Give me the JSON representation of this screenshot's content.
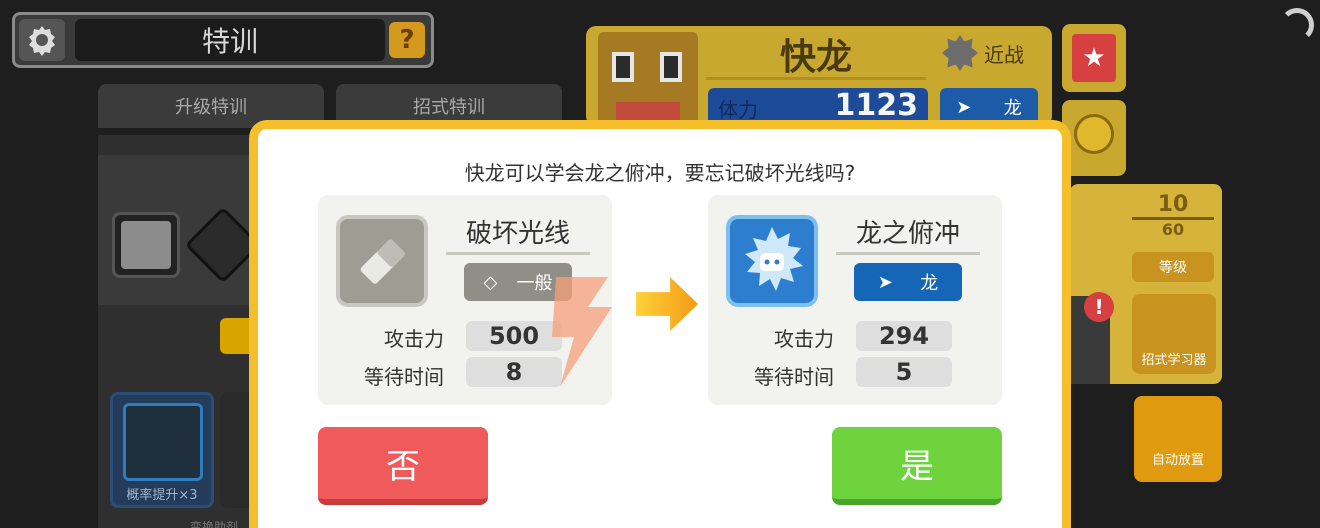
{
  "header": {
    "title": "特训",
    "help_label": "?"
  },
  "tabs": [
    {
      "label": "升级特训"
    },
    {
      "label": "招式特训"
    }
  ],
  "left_panel": {
    "boost_label": "概率提升×3",
    "bottom_text": "变换助剂"
  },
  "monster": {
    "name": "快龙",
    "attack_style": "近战",
    "hp_label": "体力",
    "hp_value": "1123",
    "type_label": "龙",
    "level": "10",
    "level_max": "60",
    "level_label": "等级",
    "move_learner_label": "招式学习器",
    "auto_place_label": "自动放置",
    "alert": "!"
  },
  "dialog": {
    "question": "快龙可以学会龙之俯冲，要忘记破坏光线吗?",
    "old_move": {
      "name": "破坏光线",
      "type": "一般",
      "attack_label": "攻击力",
      "attack_value": "500",
      "wait_label": "等待时间",
      "wait_value": "8"
    },
    "new_move": {
      "name": "龙之俯冲",
      "type": "龙",
      "attack_label": "攻击力",
      "attack_value": "294",
      "wait_label": "等待时间",
      "wait_value": "5"
    },
    "no_label": "否",
    "yes_label": "是"
  },
  "colors": {
    "frame": "#f5bf2c",
    "no_button": "#f05a5a",
    "yes_button": "#6ed33d",
    "dragon_type": "#1666b8",
    "normal_type": "#8f8f87"
  }
}
